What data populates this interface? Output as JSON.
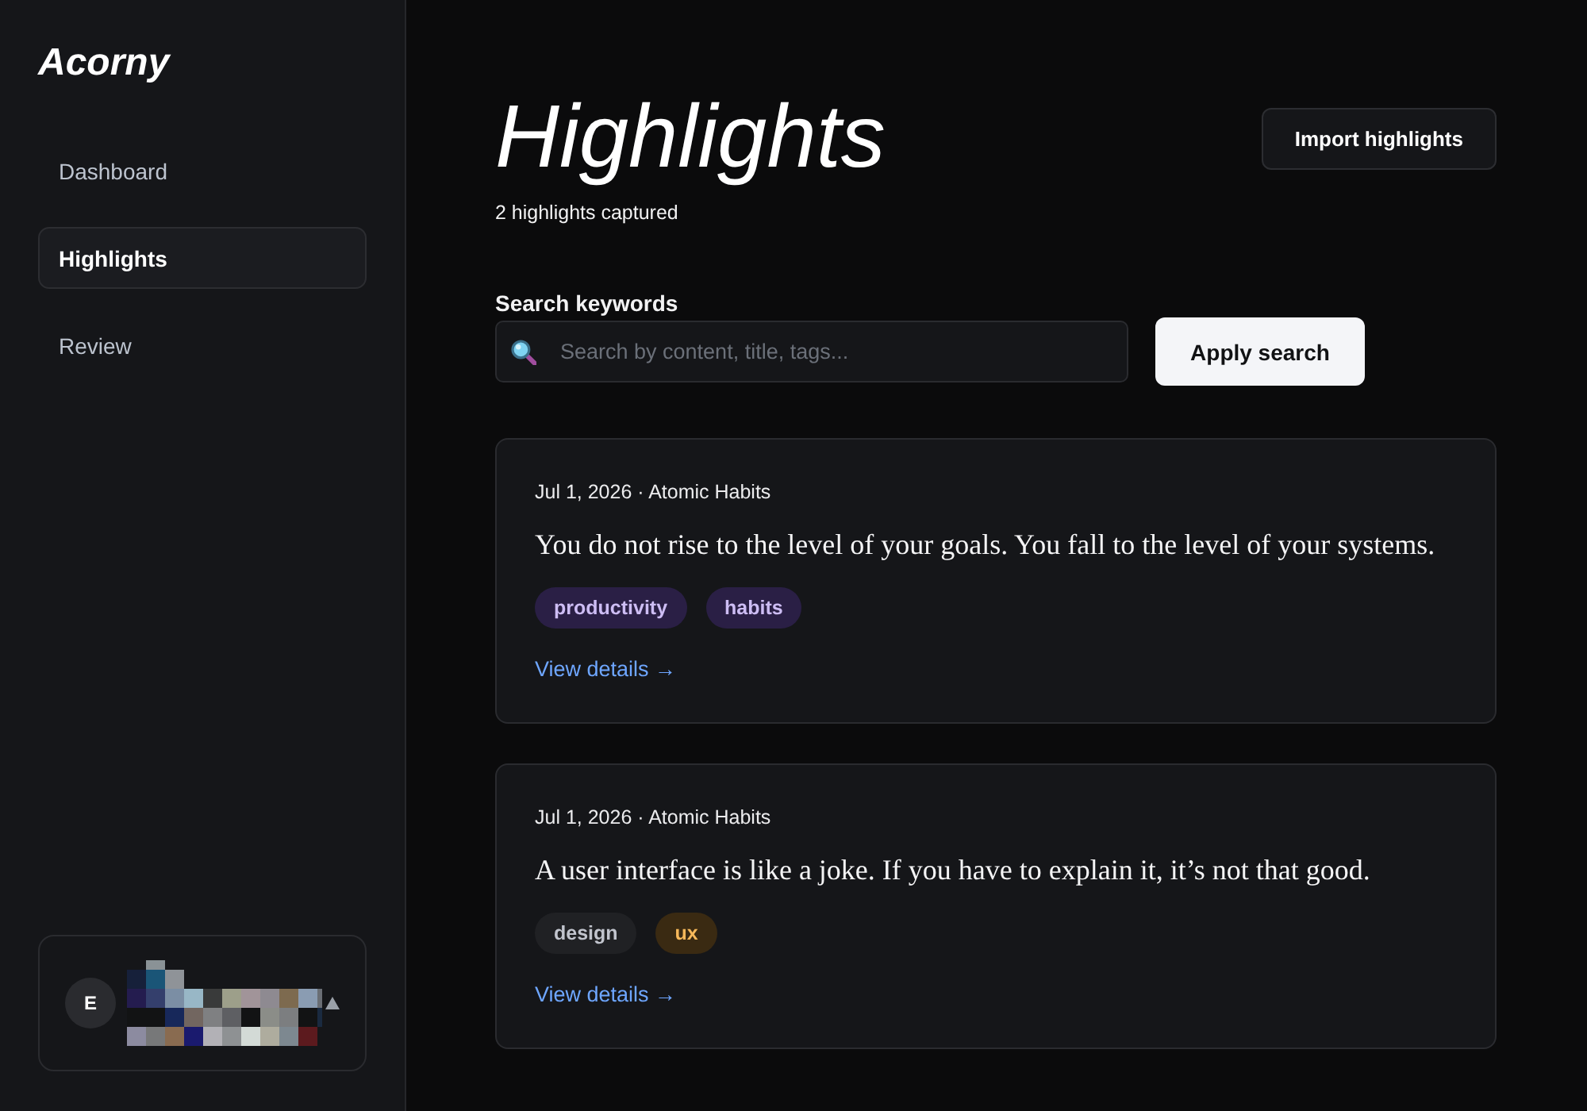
{
  "app": {
    "logo": "Acorny"
  },
  "sidebar": {
    "items": [
      {
        "label": "Dashboard",
        "selected": false
      },
      {
        "label": "Highlights",
        "selected": true
      },
      {
        "label": "Review",
        "selected": false
      }
    ]
  },
  "user": {
    "initial": "E"
  },
  "header": {
    "title": "Highlights",
    "subtitle": "2 highlights captured",
    "import_button": "Import highlights"
  },
  "search": {
    "label": "Search keywords",
    "placeholder": "Search by content, title, tags...",
    "button": "Apply search"
  },
  "highlights": [
    {
      "meta": "Jul 1, 2026 · Atomic Habits",
      "quote": "You do not rise to the level of your goals. You fall to the level of your systems.",
      "tags": [
        {
          "label": "productivity",
          "color": "#2a1f45"
        },
        {
          "label": "habits",
          "color": "#2a1f45"
        }
      ],
      "link": "View details →"
    },
    {
      "meta": "Jul 1, 2026 · Atomic Habits",
      "quote": "A user interface is like a joke. If you have to explain it, it’s not that good.",
      "tags": [
        {
          "label": "design",
          "color": "#202124"
        },
        {
          "label": "ux",
          "color": "#3a2a12"
        }
      ],
      "link": "View details →"
    }
  ]
}
